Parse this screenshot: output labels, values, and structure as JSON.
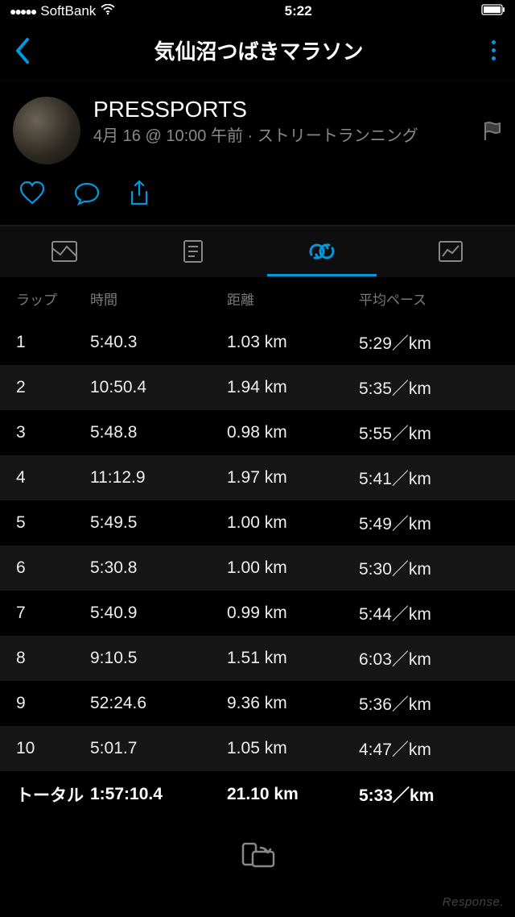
{
  "status": {
    "carrier": "SoftBank",
    "time": "5:22"
  },
  "nav": {
    "title": "気仙沼つばきマラソン"
  },
  "profile": {
    "name": "PRESSPORTS",
    "meta": "4月 16 @ 10:00 午前 · ストリートランニング"
  },
  "table": {
    "headers": {
      "lap": "ラップ",
      "time": "時間",
      "distance": "距離",
      "pace": "平均ペース"
    },
    "rows": [
      {
        "lap": "1",
        "time": "5:40.3",
        "distance": "1.03 km",
        "pace": "5:29／km"
      },
      {
        "lap": "2",
        "time": "10:50.4",
        "distance": "1.94 km",
        "pace": "5:35／km"
      },
      {
        "lap": "3",
        "time": "5:48.8",
        "distance": "0.98 km",
        "pace": "5:55／km"
      },
      {
        "lap": "4",
        "time": "11:12.9",
        "distance": "1.97 km",
        "pace": "5:41／km"
      },
      {
        "lap": "5",
        "time": "5:49.5",
        "distance": "1.00 km",
        "pace": "5:49／km"
      },
      {
        "lap": "6",
        "time": "5:30.8",
        "distance": "1.00 km",
        "pace": "5:30／km"
      },
      {
        "lap": "7",
        "time": "5:40.9",
        "distance": "0.99 km",
        "pace": "5:44／km"
      },
      {
        "lap": "8",
        "time": "9:10.5",
        "distance": "1.51 km",
        "pace": "6:03／km"
      },
      {
        "lap": "9",
        "time": "52:24.6",
        "distance": "9.36 km",
        "pace": "5:36／km"
      },
      {
        "lap": "10",
        "time": "5:01.7",
        "distance": "1.05 km",
        "pace": "4:47／km"
      }
    ],
    "total": {
      "label": "トータル",
      "time": "1:57:10.4",
      "distance": "21.10 km",
      "pace": "5:33／km"
    }
  },
  "watermark": "Response."
}
